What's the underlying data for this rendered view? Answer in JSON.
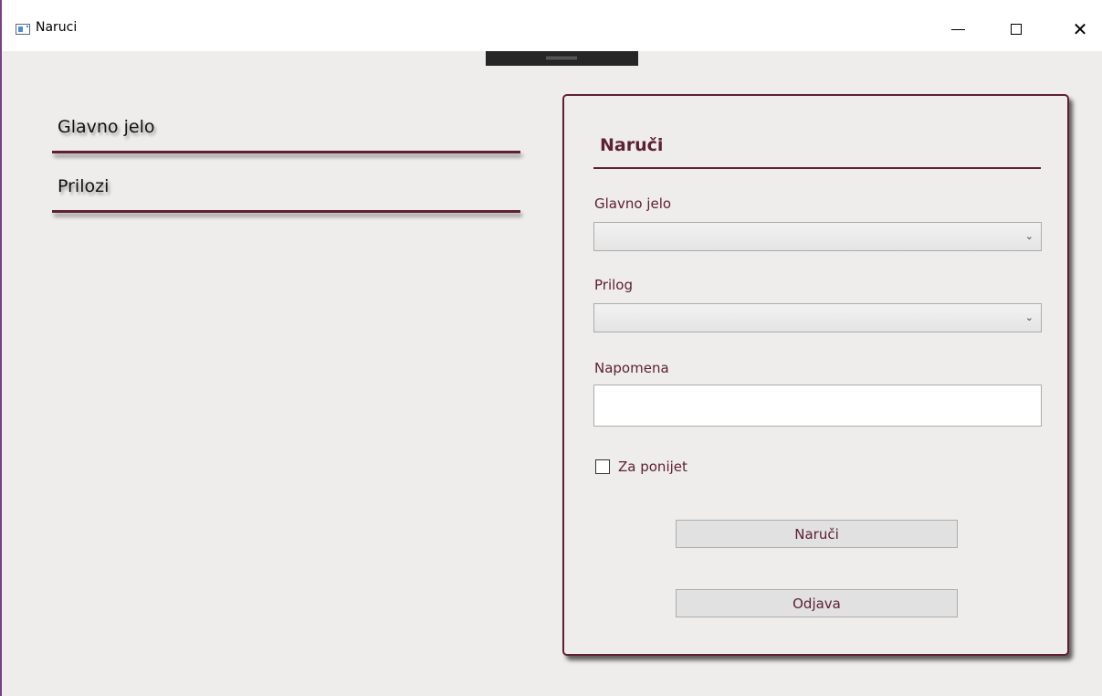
{
  "window": {
    "title": "Naruci",
    "controls": {
      "minimize": "—",
      "maximize": "☐",
      "close": "✕"
    }
  },
  "menu": {
    "items": [
      {
        "label": "Glavno jelo"
      },
      {
        "label": "Prilozi"
      }
    ]
  },
  "order_panel": {
    "title": "Naruči",
    "main_dish": {
      "label": "Glavno jelo",
      "value": ""
    },
    "side_dish": {
      "label": "Prilog",
      "value": ""
    },
    "note": {
      "label": "Napomena",
      "value": ""
    },
    "takeaway": {
      "label": "Za ponijet",
      "checked": false
    },
    "order_button": "Naruči",
    "logout_button": "Odjava"
  },
  "colors": {
    "accent": "#5d2035",
    "background": "#efedeb",
    "window_border": "#7b3f86"
  },
  "icons": {
    "app": "window-app-icon",
    "dropdown": "chevron-down-icon"
  }
}
